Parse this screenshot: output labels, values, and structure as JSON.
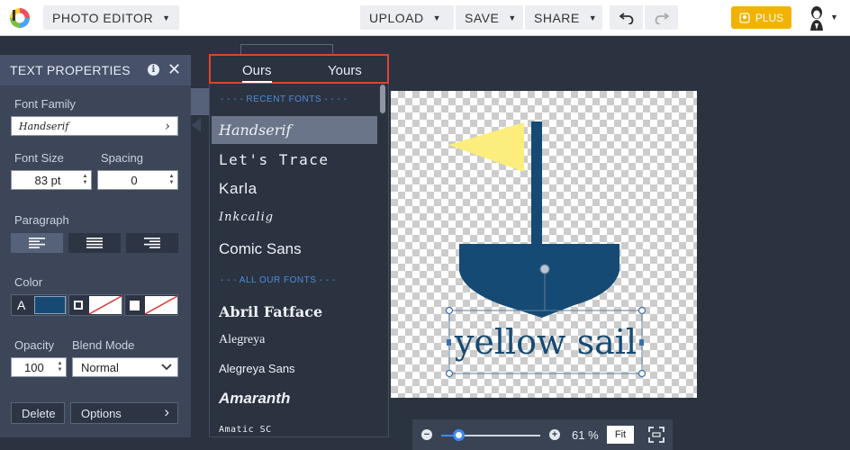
{
  "topbar": {
    "app_title": "PHOTO EDITOR",
    "upload_label": "UPLOAD",
    "save_label": "SAVE",
    "share_label": "SHARE",
    "plus_label": "PLUS",
    "accent": "#f2b200"
  },
  "panel": {
    "title": "TEXT PROPERTIES",
    "font_family_label": "Font Family",
    "font_family_value": "Handserif",
    "font_size_label": "Font Size",
    "font_size_value": "83 pt",
    "spacing_label": "Spacing",
    "spacing_value": "0",
    "paragraph_label": "Paragraph",
    "color_label": "Color",
    "color_a": "A",
    "text_color": "#174a73",
    "opacity_label": "Opacity",
    "opacity_value": "100",
    "blend_label": "Blend Mode",
    "blend_value": "Normal",
    "delete_label": "Delete",
    "options_label": "Options"
  },
  "font_menu": {
    "tab_ours": "Ours",
    "tab_yours": "Yours",
    "recent_header": "- - - - RECENT FONTS - - - -",
    "all_header": "- - - ALL OUR FONTS - - -",
    "recent": [
      "Handserif",
      "Let's Trace",
      "Karla",
      "Inkcalig",
      "Comic Sans"
    ],
    "all": [
      "Abril Fatface",
      "Alegreya",
      "Alegreya Sans",
      "Amaranth",
      "Amatic SC"
    ]
  },
  "canvas": {
    "text": "yellow sail",
    "flag_color": "#fbee7c",
    "boat_color": "#154a74"
  },
  "zoom": {
    "percent": "61 %",
    "fit_label": "Fit",
    "level": 0.18
  }
}
